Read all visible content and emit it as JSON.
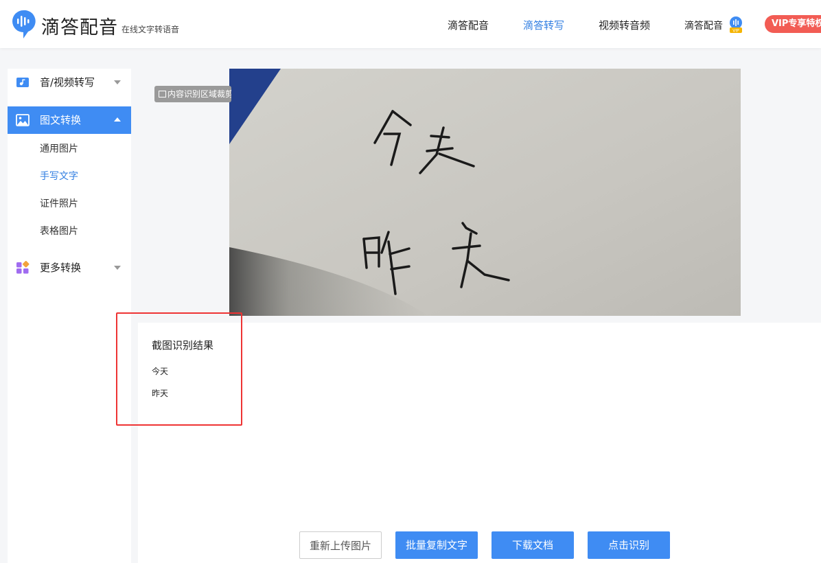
{
  "header": {
    "brand": "滴答配音",
    "slogan": "在线文字转语音",
    "nav": [
      {
        "label": "滴答配音",
        "active": false
      },
      {
        "label": "滴答转写",
        "active": true
      },
      {
        "label": "视频转音频",
        "active": false
      },
      {
        "label": "滴答配音",
        "active": false
      }
    ],
    "vip_label": "VIP专享特权",
    "vip_badge": "VIP",
    "accent": "#2f7de1",
    "vip_color": "#f25c54"
  },
  "sidebar": {
    "groups": [
      {
        "label": "音/视频转写",
        "icon": "video-icon",
        "expanded": false
      },
      {
        "label": "图文转换",
        "icon": "image-icon",
        "expanded": true,
        "items": [
          {
            "label": "通用图片",
            "active": false
          },
          {
            "label": "手写文字",
            "active": true
          },
          {
            "label": "证件照片",
            "active": false
          },
          {
            "label": "表格图片",
            "active": false
          }
        ]
      },
      {
        "label": "更多转换",
        "icon": "apps-icon",
        "expanded": false
      }
    ]
  },
  "image_area": {
    "crop_tag": "内容识别区域裁剪",
    "handwriting": [
      "今天",
      "昨天"
    ]
  },
  "result": {
    "title": "截图识别结果",
    "lines": [
      "今天",
      "昨天"
    ]
  },
  "actions": {
    "reupload": "重新上传图片",
    "batch_copy": "批量复制文字",
    "download": "下载文档",
    "recognize": "点击识别"
  }
}
